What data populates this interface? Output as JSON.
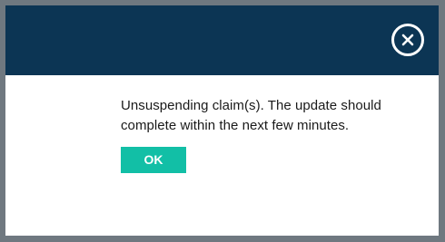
{
  "dialog": {
    "message": "Unsuspending claim(s). The update should complete within the next few minutes.",
    "ok_label": "OK",
    "close_icon": "close-icon",
    "colors": {
      "header": "#0c3554",
      "ok_button": "#12bfa6",
      "frame": "#6f7880"
    }
  }
}
